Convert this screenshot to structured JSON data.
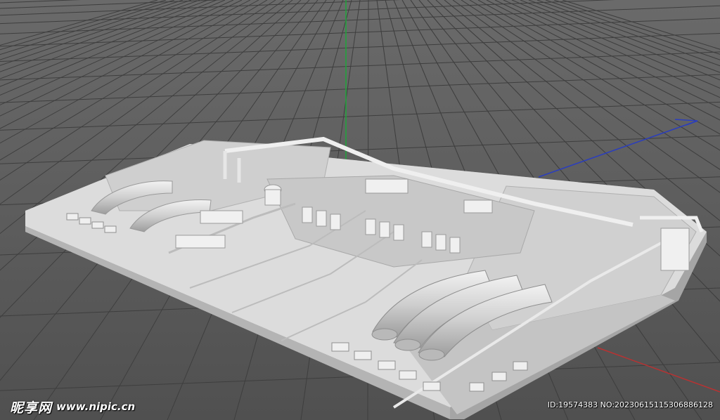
{
  "viewport": {
    "background_color": "#595959",
    "grid_line_color": "#3e3e3e",
    "axis_y_color": "#1fa53a",
    "axis_z_color": "#2b3ebd",
    "axis_x_color": "#b83232",
    "model_color": "#d8d8d8"
  },
  "watermark": {
    "site_name": "昵享网",
    "site_url": "www.nipic.cn",
    "image_info": "ID:19574383 NO:20230615115306886128"
  }
}
